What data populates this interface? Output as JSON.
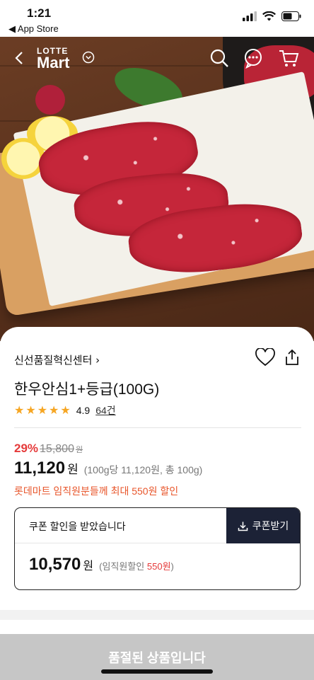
{
  "status_bar": {
    "time": "1:21",
    "back_label": "◀ App Store"
  },
  "brand": {
    "line1": "LOTTE",
    "line2": "Mart"
  },
  "product": {
    "seller": "신선품질혁신센터 ›",
    "name": "한우안심1+등급(100G)",
    "rating": "4.9",
    "stars": 5,
    "review_count": "64건",
    "discount_rate": "29%",
    "original_price": "15,800",
    "original_price_unit": "원",
    "price": "11,120",
    "price_unit": "원",
    "unit_price": "(100g당 11,120원, 총 100g)",
    "employee_note": "롯데마트 임직원분들께 최대 550원 할인"
  },
  "coupon": {
    "message": "쿠폰 할인을 받았습니다",
    "button_label": "쿠폰받기",
    "price": "10,570",
    "price_unit": "원",
    "note_prefix": "(임직원할인 ",
    "note_amount": "550원",
    "note_suffix": ")"
  },
  "bottom": {
    "soldout_label": "품절된 상품입니다"
  },
  "colors": {
    "accent_red": "#e53a3a",
    "navy": "#1c2236",
    "orange": "#e8562b",
    "star": "#f6a623"
  }
}
